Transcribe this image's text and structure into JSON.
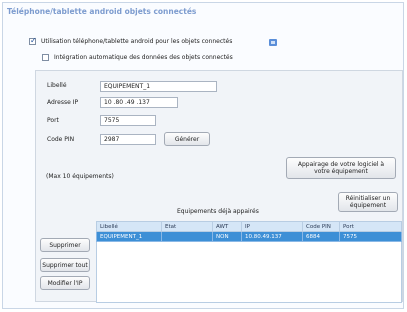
{
  "title": "Téléphone/tablette android objets connectés",
  "checkboxes": {
    "use": {
      "label": "Utilisation téléphone/tablette android pour les objets connectés",
      "checked": true
    },
    "auto": {
      "label": "Intégration automatique des données des objets connectés",
      "checked": false
    }
  },
  "form": {
    "libelle_label": "Libellé",
    "libelle_value": "EQUIPEMENT_1",
    "ip_label": "Adresse IP",
    "ip_value": "10 .80 .49 .137",
    "port_label": "Port",
    "port_value": "7575",
    "pin_label": "Code PIN",
    "pin_value": "2987",
    "generate_label": "Générer",
    "max_note": "(Max 10 équipements)"
  },
  "buttons": {
    "pairing_line1": "Appairage de votre logiciel à",
    "pairing_line2": "votre équipement",
    "reset_line1": "Réinitialiser un",
    "reset_line2": "équipement",
    "delete": "Supprimer",
    "delete_all": "Supprimer tout",
    "edit_ip": "Modifier l'IP"
  },
  "table": {
    "caption": "Equipements déjà appairés",
    "headers": [
      "Libellé",
      "Etat",
      "AWT",
      "IP",
      "Code PIN",
      "Port"
    ],
    "rows": [
      [
        "EQUIPEMENT_1",
        "",
        "NON",
        "10.80.49.137",
        "6884",
        "7575"
      ]
    ]
  },
  "colors": {
    "title": "#7d9ccf",
    "selected_row": "#3d8fd6",
    "header": "#d5e6f7"
  }
}
